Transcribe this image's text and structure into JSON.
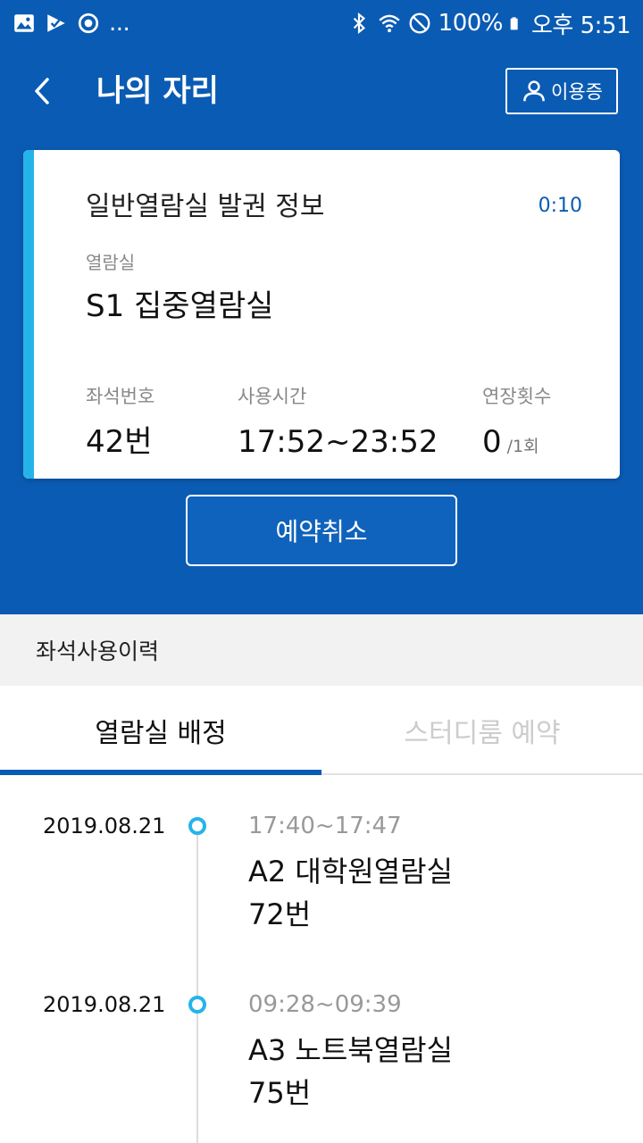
{
  "status_bar": {
    "dots": "...",
    "battery": "100%",
    "time": "오후 5:51",
    "left_icons": [
      "gallery-icon",
      "download-check-icon",
      "sync-icon"
    ],
    "right_icons": [
      "bluetooth-icon",
      "wifi-icon",
      "no-sound-icon",
      "battery-icon"
    ]
  },
  "header": {
    "title": "나의 자리",
    "member_button": "이용증"
  },
  "ticket": {
    "title": "일반열람실 발권 정보",
    "timer": "0:10",
    "room_label": "열람실",
    "room_name": "S1 집중열람실",
    "seat_label": "좌석번호",
    "seat_value": "42번",
    "time_label": "사용시간",
    "time_value": "17:52~23:52",
    "extend_label": "연장횟수",
    "extend_value": "0",
    "extend_suffix": "/1회"
  },
  "cancel_button": "예약취소",
  "history": {
    "title": "좌석사용이력",
    "tabs": [
      {
        "label": "열람실 배정",
        "active": true
      },
      {
        "label": "스터디룸 예약",
        "active": false
      }
    ],
    "entries": [
      {
        "date": "2019.08.21",
        "time": "17:40~17:47",
        "room": "A2 대학원열람실",
        "seat": "72번"
      },
      {
        "date": "2019.08.21",
        "time": "09:28~09:39",
        "room": "A3 노트북열람실",
        "seat": "75번"
      }
    ]
  },
  "colors": {
    "primary": "#0a5bb3",
    "accent": "#25b4ea"
  }
}
